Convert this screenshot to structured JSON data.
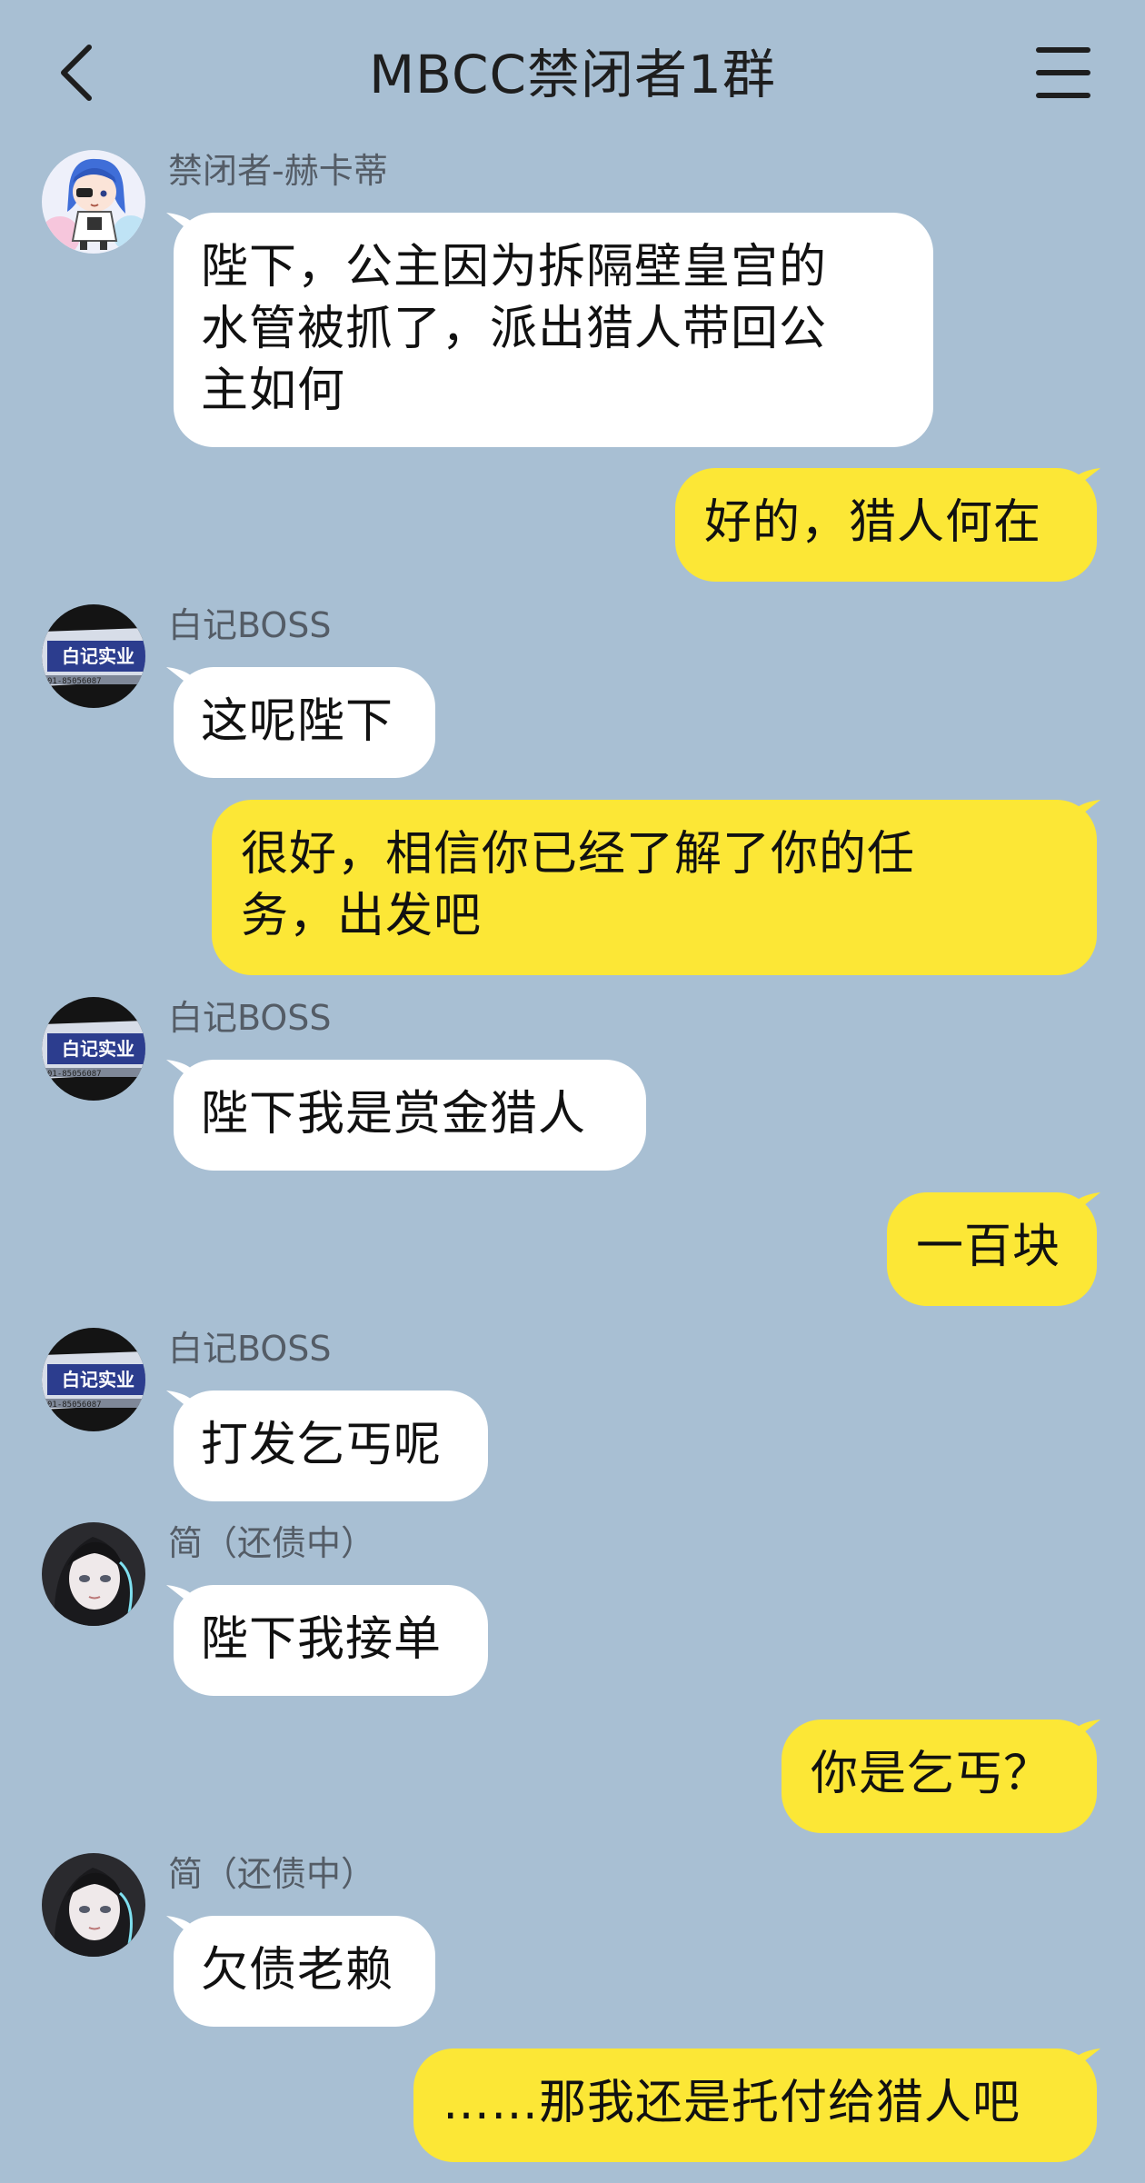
{
  "header": {
    "title": "MBCC禁闭者1群",
    "back_icon": "chevron-left-icon",
    "menu_icon": "hamburger-menu-icon"
  },
  "colors": {
    "background": "#a8bfd3",
    "self_bubble": "#fce736",
    "other_bubble": "#ffffff",
    "sender_text": "#545c66"
  },
  "messages": [
    {
      "side": "left",
      "sender": "禁闭者-赫卡蒂",
      "avatar": "hecate-avatar",
      "text": "陛下，公主因为拆隔壁皇宫的\n水管被抓了，派出猎人带回公\n主如何"
    },
    {
      "side": "right",
      "text": "好的，猎人何在"
    },
    {
      "side": "left",
      "sender": "白记BOSS",
      "avatar": "baiji-boss-avatar",
      "text": "这呢陛下"
    },
    {
      "side": "right",
      "text": "很好，相信你已经了解了你的任\n务，出发吧"
    },
    {
      "side": "left",
      "sender": "白记BOSS",
      "avatar": "baiji-boss-avatar",
      "text": "陛下我是赏金猎人"
    },
    {
      "side": "right",
      "text": "一百块"
    },
    {
      "side": "left",
      "sender": "白记BOSS",
      "avatar": "baiji-boss-avatar",
      "text": "打发乞丐呢"
    },
    {
      "side": "left",
      "sender": "简（还债中）",
      "avatar": "jane-avatar",
      "text": "陛下我接单"
    },
    {
      "side": "right",
      "text": "你是乞丐？"
    },
    {
      "side": "left",
      "sender": "简（还债中）",
      "avatar": "jane-avatar",
      "text": "欠债老赖"
    },
    {
      "side": "right",
      "text": "……那我还是托付给猎人吧"
    }
  ],
  "avatar_badge_text": "白记实业"
}
